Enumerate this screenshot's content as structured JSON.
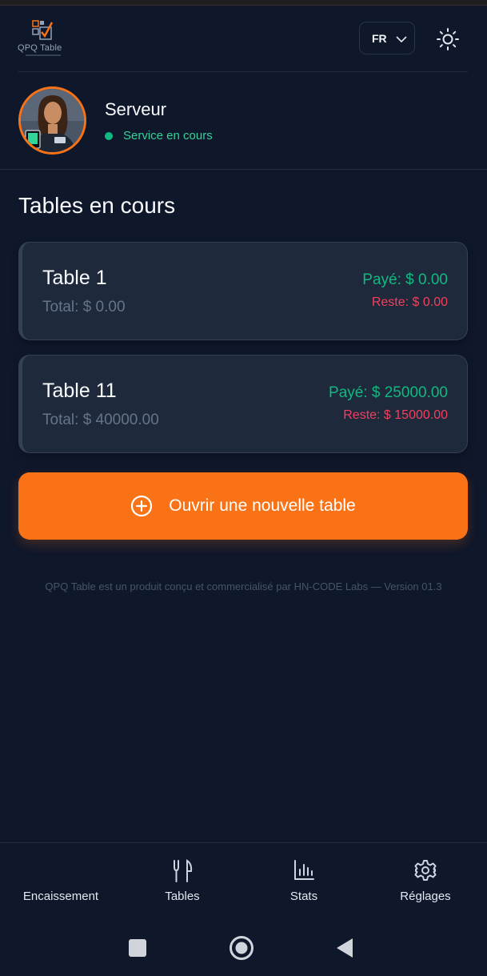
{
  "header": {
    "logo_text": "QPQ Table",
    "language": "FR"
  },
  "profile": {
    "role": "Serveur",
    "status": "Service en cours"
  },
  "section_title": "Tables en cours",
  "tables": [
    {
      "name": "Table 1",
      "total": "Total: $ 0.00",
      "paid": "Payé: $ 0.00",
      "remaining": "Reste: $ 0.00"
    },
    {
      "name": "Table 11",
      "total": "Total: $ 40000.00",
      "paid": "Payé: $ 25000.00",
      "remaining": "Reste: $ 15000.00"
    }
  ],
  "cta_label": "Ouvrir une nouvelle table",
  "footer_note": "QPQ Table est un produit conçu et commercialisé par HN-CODE Labs — Version 01.3",
  "nav": [
    {
      "label": "Encaissement",
      "icon": ""
    },
    {
      "label": "Tables",
      "icon": "fork-knife-icon"
    },
    {
      "label": "Stats",
      "icon": "bar-chart-icon"
    },
    {
      "label": "Réglages",
      "icon": "gear-icon"
    }
  ],
  "colors": {
    "background": "#0f172a",
    "accent": "#f97316",
    "paid": "#10b981",
    "remaining": "#f43f5e",
    "card": "#1e293b"
  }
}
